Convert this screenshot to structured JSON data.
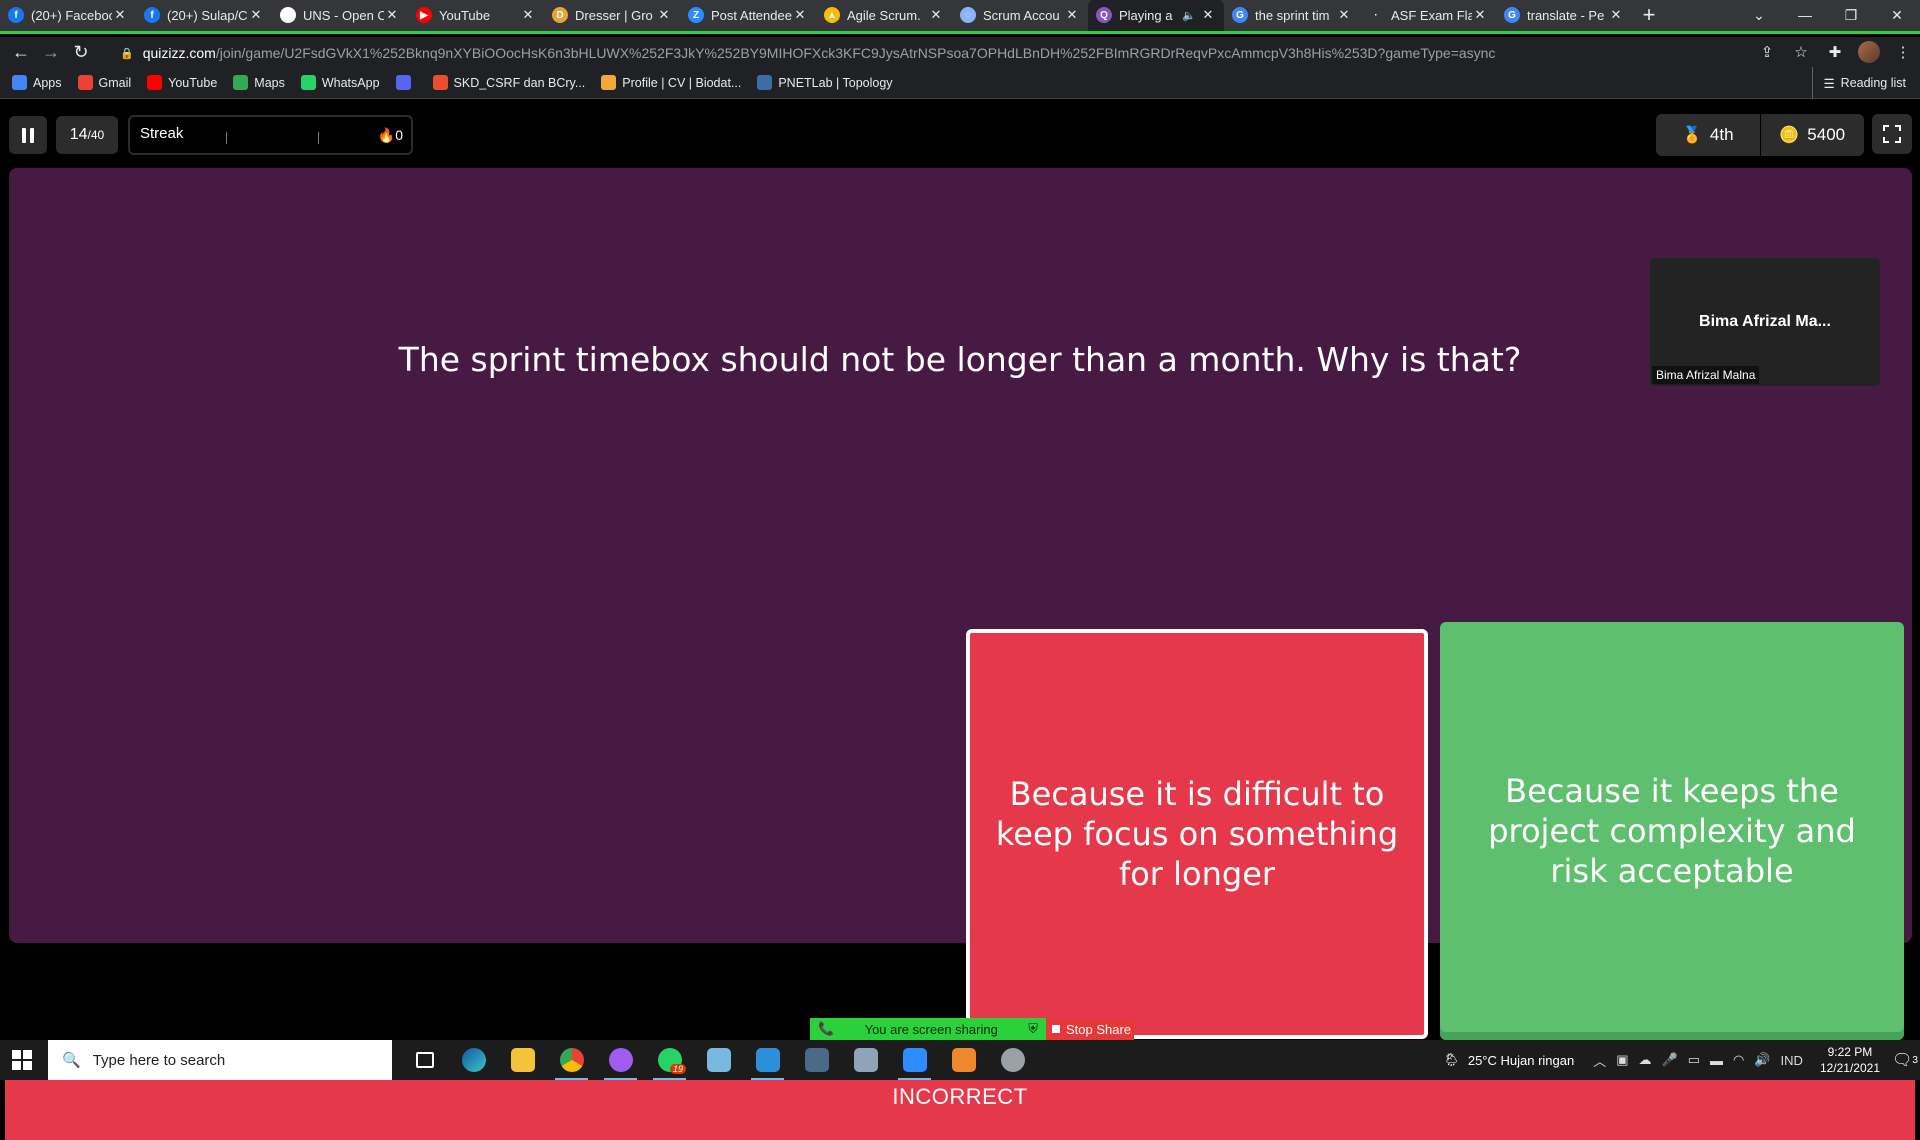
{
  "browser": {
    "tabs": [
      {
        "title": "(20+) Facebook",
        "color": "#1877f2",
        "glyph": "f"
      },
      {
        "title": "(20+) Sulap/C",
        "color": "#1877f2",
        "glyph": "f"
      },
      {
        "title": "UNS - Open C",
        "color": "#ffffff",
        "glyph": "●"
      },
      {
        "title": "YouTube",
        "color": "#ff0000",
        "glyph": "▶"
      },
      {
        "title": "Dresser | Gro",
        "color": "#e8a33c",
        "glyph": "D"
      },
      {
        "title": "Post Attendee",
        "color": "#2d8cff",
        "glyph": "Z"
      },
      {
        "title": "Agile Scrum.",
        "color": "#fbbc04",
        "glyph": "▲"
      },
      {
        "title": "Scrum Accou",
        "color": "#8ab4f8",
        "glyph": "◌"
      },
      {
        "title": "Playing a",
        "color": "#8854c0",
        "glyph": "Q"
      },
      {
        "title": "the sprint tim",
        "color": "#4285f4",
        "glyph": "G"
      },
      {
        "title": "ASF Exam Fla",
        "color": "#35363a",
        "glyph": "·"
      },
      {
        "title": "translate - Pe",
        "color": "#4285f4",
        "glyph": "G"
      }
    ],
    "url_host": "quizizz.com",
    "url_path": "/join/game/U2FsdGVkX1%252Bknq9nXYBiOOocHsK6n3bHLUWX%252F3JkY%252BY9MIHOFXck3KFC9JysAtrNSPsoa7OPHdLBnDH%252FBImRGRDrReqvPxcAmmcpV3h8His%253D?gameType=async",
    "bookmarks": [
      {
        "label": "Apps",
        "color": "#4285f4"
      },
      {
        "label": "Gmail",
        "color": "#ea4335"
      },
      {
        "label": "YouTube",
        "color": "#ff0000"
      },
      {
        "label": "Maps",
        "color": "#34a853"
      },
      {
        "label": "WhatsApp",
        "color": "#25d366"
      },
      {
        "label": "",
        "color": "#5865f2"
      },
      {
        "label": "SKD_CSRF dan BCry...",
        "color": "#e94e2f"
      },
      {
        "label": "Profile | CV | Biodat...",
        "color": "#f2a93b"
      },
      {
        "label": "PNETLab | Topology",
        "color": "#3a6ea5"
      }
    ],
    "reading_list": "Reading list"
  },
  "quiz": {
    "progress_current": "14",
    "progress_total": "/40",
    "streak_label": "Streak",
    "streak_value": "0",
    "rank": "4th",
    "score": "5400",
    "participant_name": "Bima Afrizal Ma...",
    "participant_tag": "Bima Afrizal Malna",
    "question": "The sprint timebox should not be longer than a month. Why is that?",
    "options": [
      {
        "text": "Because it is difficult to keep focus on something for longer",
        "color": "#e5384b",
        "state": "selected-incorrect"
      },
      {
        "text": "Because it keeps the project complexity and risk acceptable",
        "color": "#5ebf6f",
        "state": "correct"
      }
    ],
    "feedback": "INCORRECT",
    "screen_share_text": "You are screen sharing",
    "stop_share_label": "Stop Share"
  },
  "taskbar": {
    "search_placeholder": "Type here to search",
    "weather": "25°C  Hujan ringan",
    "language": "IND",
    "time": "9:22 PM",
    "date": "12/21/2021",
    "notification_count": "3",
    "whatsapp_badge": "19"
  }
}
